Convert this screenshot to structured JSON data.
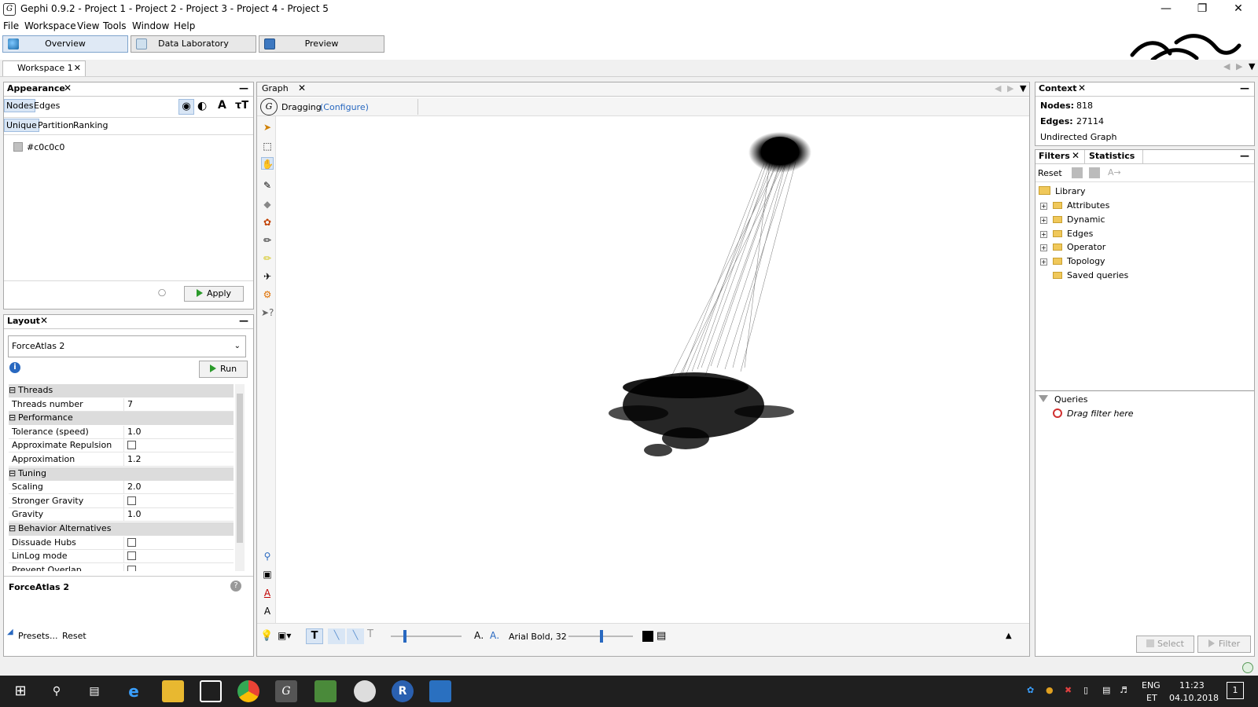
{
  "window": {
    "title": "Gephi 0.9.2 - Project 1 - Project 2 - Project 3 - Project 4 - Project 5",
    "minimize_icon": "minimize-icon",
    "restore_icon": "restore-icon",
    "close_icon": "close-icon"
  },
  "menu": [
    "File",
    "Workspace",
    "View",
    "Tools",
    "Window",
    "Help"
  ],
  "modes": {
    "overview": "Overview",
    "data_lab": "Data Laboratory",
    "preview": "Preview"
  },
  "workspace_tab": "Workspace 1",
  "appearance": {
    "title": "Appearance",
    "tabs": [
      "Nodes",
      "Edges"
    ],
    "subtabs": [
      "Unique",
      "Partition",
      "Ranking"
    ],
    "color_value": "#c0c0c0",
    "apply": "Apply"
  },
  "layout": {
    "title": "Layout",
    "algorithm": "ForceAtlas 2",
    "run": "Run",
    "props": [
      {
        "type": "cat",
        "key": "Threads"
      },
      {
        "type": "val",
        "key": "Threads number",
        "value": "7"
      },
      {
        "type": "cat",
        "key": "Performance"
      },
      {
        "type": "val",
        "key": "Tolerance (speed)",
        "value": "1.0"
      },
      {
        "type": "chk",
        "key": "Approximate Repulsion",
        "value": ""
      },
      {
        "type": "val",
        "key": "Approximation",
        "value": "1.2"
      },
      {
        "type": "cat",
        "key": "Tuning"
      },
      {
        "type": "val",
        "key": "Scaling",
        "value": "2.0"
      },
      {
        "type": "chk",
        "key": "Stronger Gravity",
        "value": ""
      },
      {
        "type": "val",
        "key": "Gravity",
        "value": "1.0"
      },
      {
        "type": "cat",
        "key": "Behavior Alternatives"
      },
      {
        "type": "chk",
        "key": "Dissuade Hubs",
        "value": ""
      },
      {
        "type": "chk",
        "key": "LinLog mode",
        "value": ""
      },
      {
        "type": "chk",
        "key": "Prevent Overlap",
        "value": ""
      }
    ],
    "desc_title": "ForceAtlas 2",
    "presets": "Presets...",
    "reset": "Reset"
  },
  "graph": {
    "tab": "Graph",
    "tool_status": "Dragging",
    "configure": "(Configure)",
    "font_label": "Arial Bold, 32"
  },
  "context": {
    "title": "Context",
    "nodes_label": "Nodes:",
    "nodes_value": "818",
    "edges_label": "Edges:",
    "edges_value": "27114",
    "graph_type": "Undirected Graph"
  },
  "filters": {
    "tabs": [
      "Filters",
      "Statistics"
    ],
    "reset": "Reset",
    "library": "Library",
    "items": [
      "Attributes",
      "Dynamic",
      "Edges",
      "Operator",
      "Topology",
      "Saved queries"
    ],
    "queries": "Queries",
    "drag_hint": "Drag filter here",
    "select": "Select",
    "filter": "Filter"
  },
  "taskbar": {
    "lang": "ENG",
    "lang_sub": "ET",
    "time": "11:23",
    "date": "04.10.2018",
    "notif_count": "1"
  }
}
